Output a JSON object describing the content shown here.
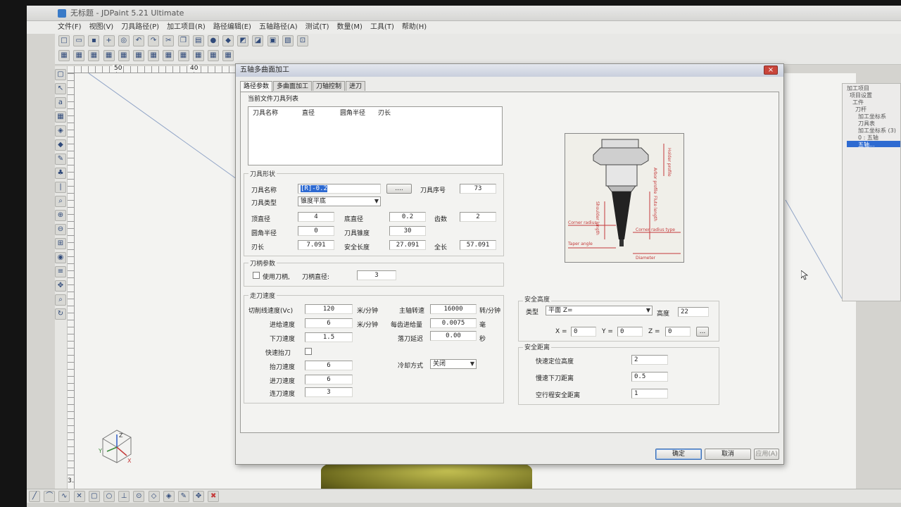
{
  "app": {
    "title": "无标题 - JDPaint 5.21 Ultimate",
    "menu": [
      "文件(F)",
      "视图(V)",
      "刀具路径(P)",
      "加工项目(R)",
      "路径编辑(E)",
      "五轴路径(A)",
      "测试(T)",
      "数量(M)",
      "工具(T)",
      "帮助(H)"
    ]
  },
  "ruler": {
    "top_labels": [
      "50",
      "40"
    ],
    "left_labels": [
      "3"
    ]
  },
  "axis": {
    "x": "X",
    "y": "Y",
    "z": "Z"
  },
  "tree": {
    "items": [
      "加工项目",
      "项目设置",
      "工件",
      "刀杆",
      "加工坐标系",
      "刀具表",
      "加工坐标系 (3)",
      "0 : 五轴",
      "五轴..."
    ]
  },
  "dialog": {
    "title": "五轴多曲面加工",
    "close_label": "×",
    "tabs": [
      "路径参数",
      "多曲面加工",
      "刀轴控制",
      "进刀"
    ],
    "current_tools": {
      "group_title": "当前文件刀具列表",
      "headers": [
        "刀具名称",
        "直径",
        "圆角半径",
        "刃长"
      ]
    },
    "tool_shape": {
      "group_title": "刀具形状",
      "name_label": "刀具名称",
      "name_value": "[R]-0.2",
      "browse_label": "....",
      "number_label": "刀具序号",
      "number_value": "73",
      "type_label": "刀具类型",
      "type_value": "锥度平底",
      "top_dia_label": "顶直径",
      "top_dia_value": "4",
      "bottom_dia_label": "底直径",
      "bottom_dia_value": "0.2",
      "teeth_label": "齿数",
      "teeth_value": "2",
      "corner_label": "圆角半径",
      "corner_value": "0",
      "taper_label": "刀具锥度",
      "taper_value": "30",
      "blade_label": "刃长",
      "blade_value": "7.091",
      "safe_label": "安全长度",
      "safe_value": "27.091",
      "total_label": "全长",
      "total_value": "57.091"
    },
    "shank": {
      "group_title": "刀柄参数",
      "use_label": "使用刀柄,",
      "dia_label": "刀柄直径:",
      "dia_value": "3"
    },
    "diagram": {
      "labels": [
        "Holder profile",
        "Arbor profile",
        "Shoulder length",
        "Flute length",
        "Corner radius",
        "Corner radius type",
        "Taper angle",
        "Diameter"
      ]
    },
    "speed": {
      "group_title": "走刀速度",
      "cut_label": "切削线速度(Vc)",
      "cut_value": "120",
      "cut_unit": "米/分钟",
      "spindle_label": "主轴转速",
      "spindle_value": "16000",
      "spindle_unit": "转/分钟",
      "feed_label": "进给速度",
      "feed_value": "6",
      "feed_unit": "米/分钟",
      "tooth_label": "每齿进给量",
      "tooth_value": "0.0075",
      "tooth_unit": "毫",
      "down_label": "下刀速度",
      "down_value": "1.5",
      "delay_label": "落刀延迟",
      "delay_value": "0.00",
      "delay_unit": "秒",
      "rapid_label": "快速抬刀",
      "lift_label": "抬刀速度",
      "lift_value": "6",
      "in_label": "进刀速度",
      "in_value": "6",
      "link_label": "连刀速度",
      "link_value": "3",
      "cool_label": "冷却方式",
      "cool_value": "关闭"
    },
    "safe_height": {
      "group_title": "安全高度",
      "type_label": "类型",
      "type_value": "平面 Z=",
      "height_label": "高度",
      "height_value": "22",
      "x_label": "X =",
      "x_value": "0",
      "y_label": "Y =",
      "y_value": "0",
      "z_label": "Z =",
      "z_value": "0",
      "pick_label": "..."
    },
    "safe_distance": {
      "group_title": "安全距离",
      "rapid_label": "快速定位高度",
      "rapid_value": "2",
      "slow_label": "慢速下刀距离",
      "slow_value": "0.5",
      "idle_label": "空行程安全距离",
      "idle_value": "1"
    },
    "buttons": {
      "ok": "确定",
      "cancel": "取消",
      "apply": "应用(A)"
    }
  },
  "colors": {
    "selection": "#2e6ad1",
    "close": "#c9453b",
    "canvas": "#f3f3f1"
  }
}
